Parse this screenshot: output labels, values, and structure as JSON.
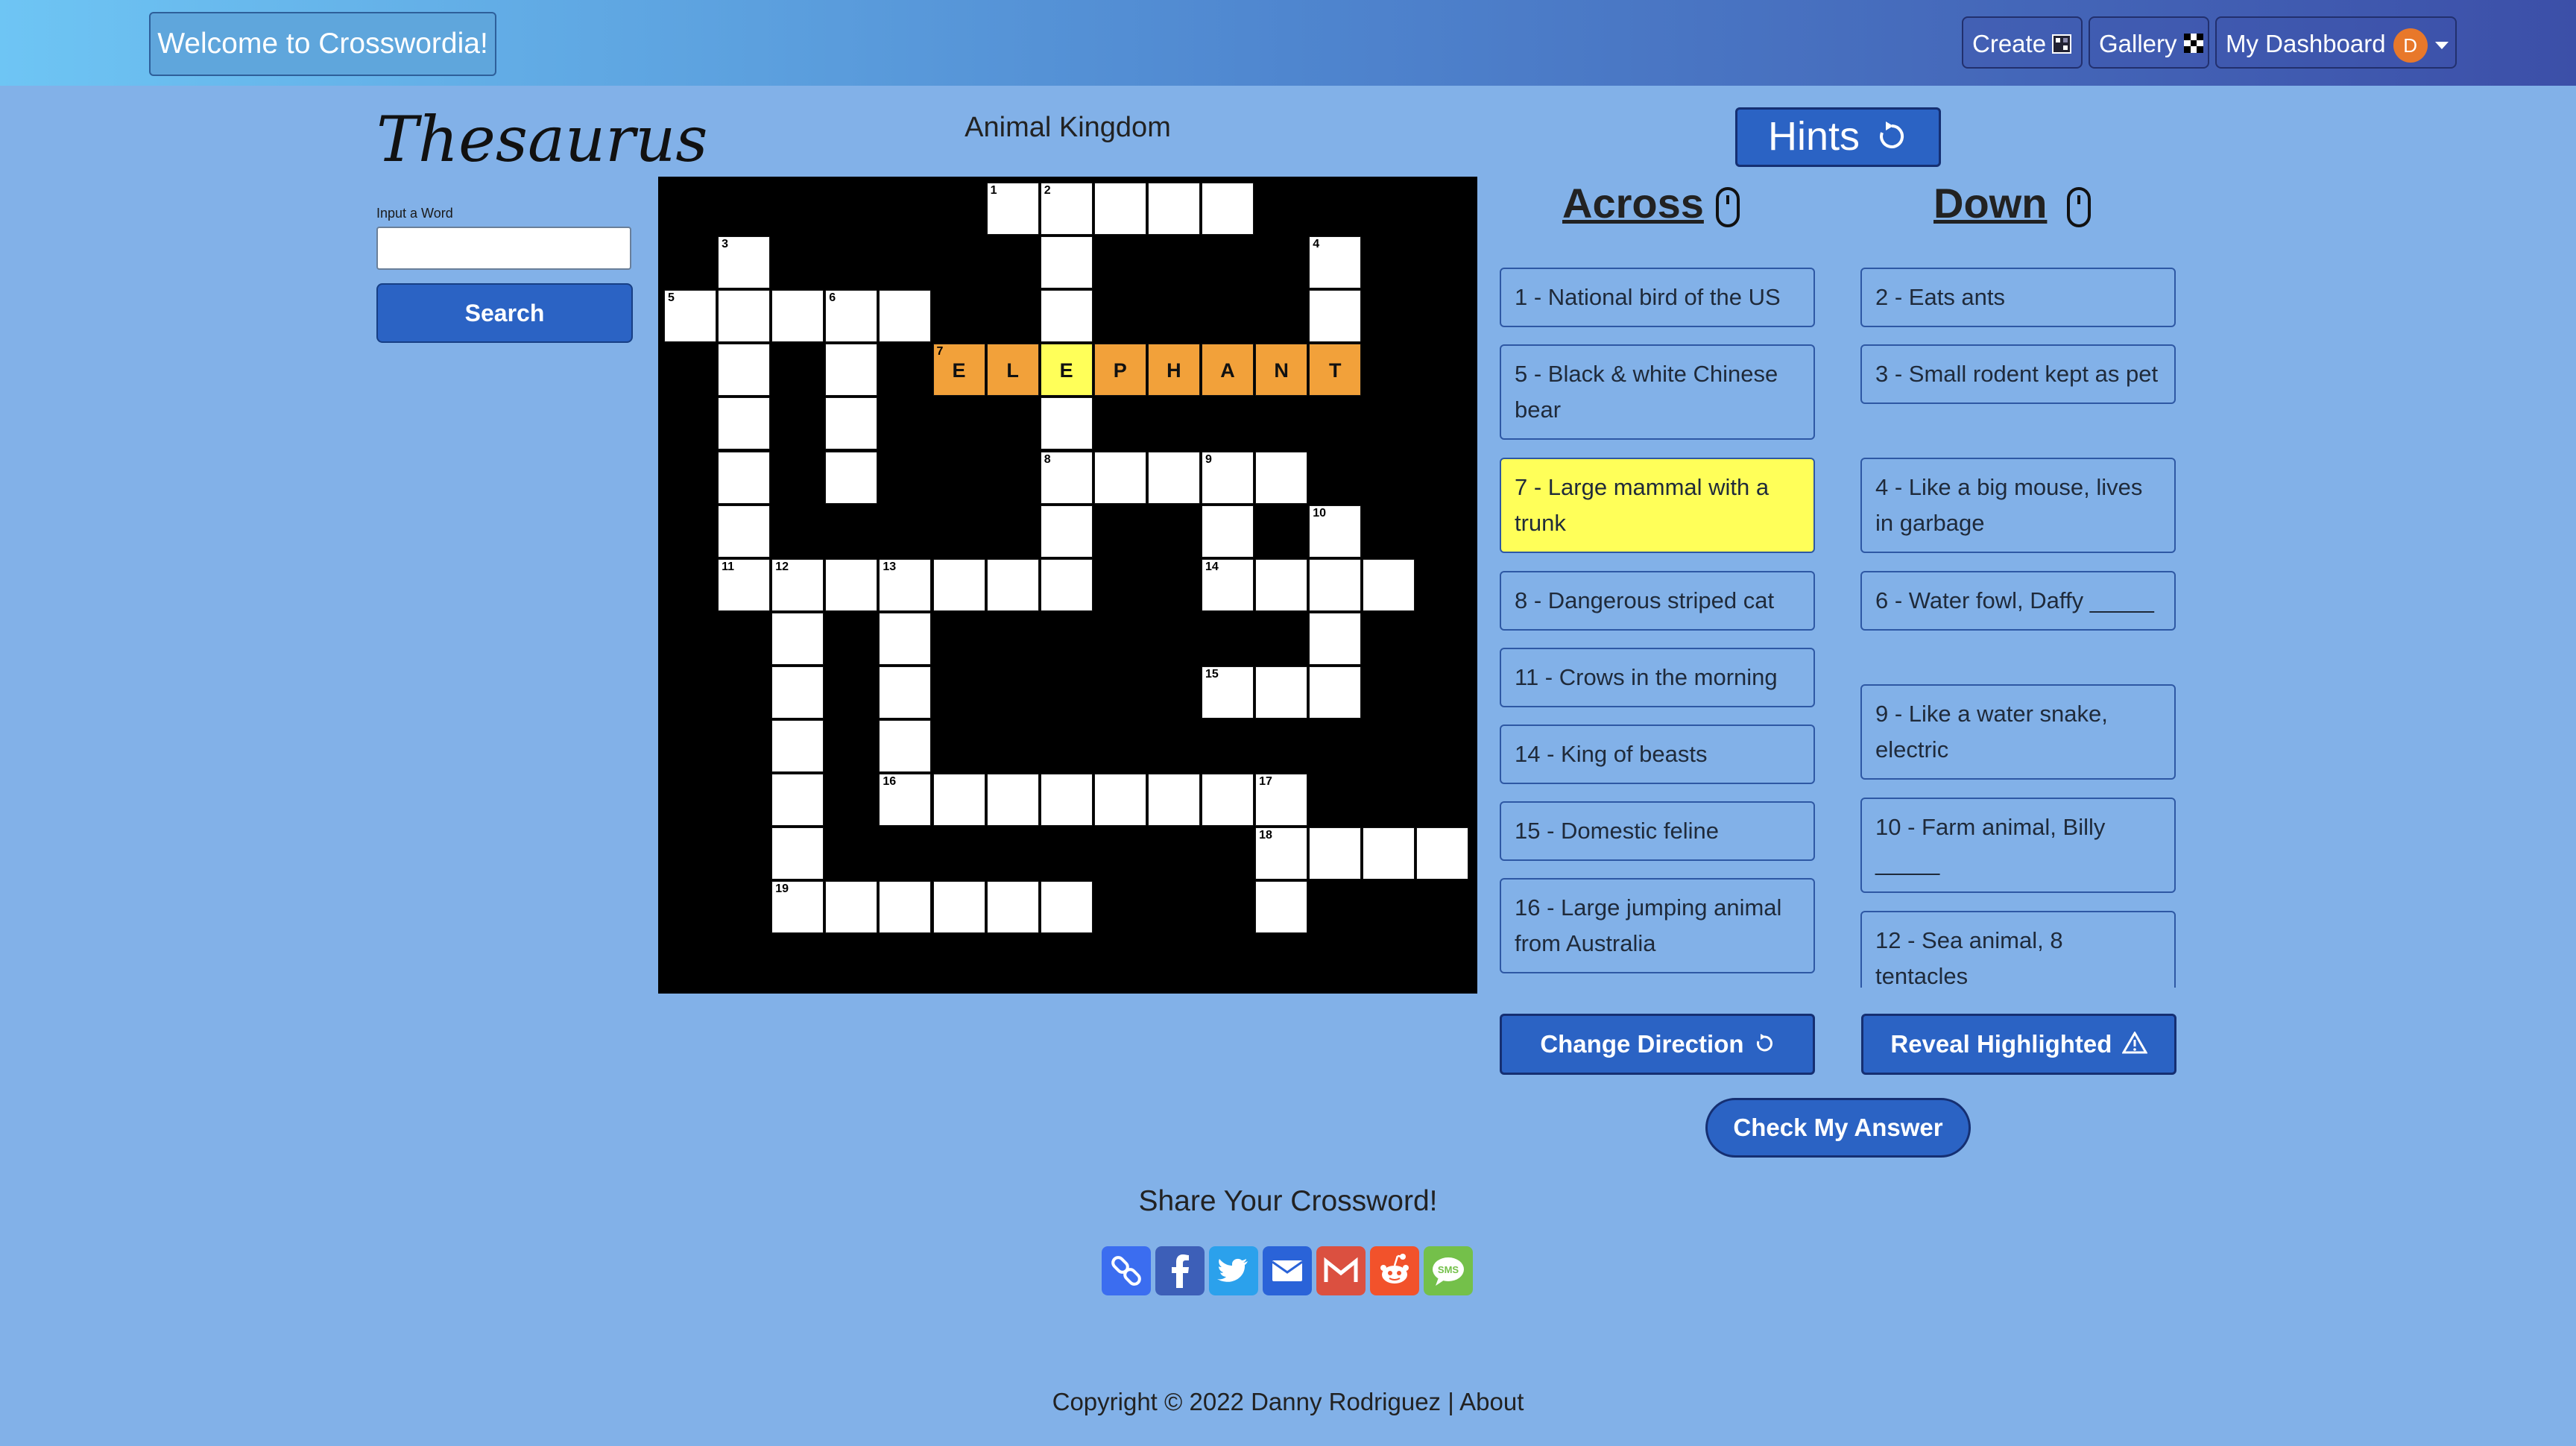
{
  "navbar": {
    "brand": "Welcome to Crosswordia!",
    "create": "Create",
    "gallery": "Gallery",
    "dashboard": "My Dashboard",
    "avatar_initial": "D"
  },
  "thesaurus": {
    "title": "Thesaurus",
    "input_label": "Input a Word",
    "input_value": "",
    "search_label": "Search"
  },
  "puzzle": {
    "title": "Animal Kingdom",
    "cells": [
      {
        "r": 0,
        "c": 6,
        "n": "1"
      },
      {
        "r": 0,
        "c": 7,
        "n": "2"
      },
      {
        "r": 0,
        "c": 8
      },
      {
        "r": 0,
        "c": 9
      },
      {
        "r": 0,
        "c": 10
      },
      {
        "r": 1,
        "c": 1,
        "n": "3"
      },
      {
        "r": 1,
        "c": 7
      },
      {
        "r": 1,
        "c": 12,
        "n": "4"
      },
      {
        "r": 2,
        "c": 0,
        "n": "5"
      },
      {
        "r": 2,
        "c": 1
      },
      {
        "r": 2,
        "c": 2
      },
      {
        "r": 2,
        "c": 3,
        "n": "6"
      },
      {
        "r": 2,
        "c": 4
      },
      {
        "r": 2,
        "c": 7
      },
      {
        "r": 2,
        "c": 12
      },
      {
        "r": 3,
        "c": 1
      },
      {
        "r": 3,
        "c": 3
      },
      {
        "r": 3,
        "c": 5,
        "n": "7",
        "l": "E",
        "hl": "o"
      },
      {
        "r": 3,
        "c": 6,
        "l": "L",
        "hl": "o"
      },
      {
        "r": 3,
        "c": 7,
        "l": "E",
        "hl": "y"
      },
      {
        "r": 3,
        "c": 8,
        "l": "P",
        "hl": "o"
      },
      {
        "r": 3,
        "c": 9,
        "l": "H",
        "hl": "o"
      },
      {
        "r": 3,
        "c": 10,
        "l": "A",
        "hl": "o"
      },
      {
        "r": 3,
        "c": 11,
        "l": "N",
        "hl": "o"
      },
      {
        "r": 3,
        "c": 12,
        "l": "T",
        "hl": "o"
      },
      {
        "r": 4,
        "c": 1
      },
      {
        "r": 4,
        "c": 3
      },
      {
        "r": 4,
        "c": 7
      },
      {
        "r": 5,
        "c": 1
      },
      {
        "r": 5,
        "c": 3
      },
      {
        "r": 5,
        "c": 7,
        "n": "8"
      },
      {
        "r": 5,
        "c": 8
      },
      {
        "r": 5,
        "c": 9
      },
      {
        "r": 5,
        "c": 10,
        "n": "9"
      },
      {
        "r": 5,
        "c": 11
      },
      {
        "r": 6,
        "c": 1
      },
      {
        "r": 6,
        "c": 7
      },
      {
        "r": 6,
        "c": 10
      },
      {
        "r": 6,
        "c": 12,
        "n": "10"
      },
      {
        "r": 7,
        "c": 1,
        "n": "11"
      },
      {
        "r": 7,
        "c": 2,
        "n": "12"
      },
      {
        "r": 7,
        "c": 3
      },
      {
        "r": 7,
        "c": 4,
        "n": "13"
      },
      {
        "r": 7,
        "c": 5
      },
      {
        "r": 7,
        "c": 6
      },
      {
        "r": 7,
        "c": 7
      },
      {
        "r": 7,
        "c": 10,
        "n": "14"
      },
      {
        "r": 7,
        "c": 11
      },
      {
        "r": 7,
        "c": 12
      },
      {
        "r": 7,
        "c": 13
      },
      {
        "r": 8,
        "c": 2
      },
      {
        "r": 8,
        "c": 4
      },
      {
        "r": 8,
        "c": 12
      },
      {
        "r": 9,
        "c": 2
      },
      {
        "r": 9,
        "c": 4
      },
      {
        "r": 9,
        "c": 10,
        "n": "15"
      },
      {
        "r": 9,
        "c": 11
      },
      {
        "r": 9,
        "c": 12
      },
      {
        "r": 10,
        "c": 2
      },
      {
        "r": 10,
        "c": 4
      },
      {
        "r": 11,
        "c": 2
      },
      {
        "r": 11,
        "c": 4,
        "n": "16"
      },
      {
        "r": 11,
        "c": 5
      },
      {
        "r": 11,
        "c": 6
      },
      {
        "r": 11,
        "c": 7
      },
      {
        "r": 11,
        "c": 8
      },
      {
        "r": 11,
        "c": 9
      },
      {
        "r": 11,
        "c": 10
      },
      {
        "r": 11,
        "c": 11,
        "n": "17"
      },
      {
        "r": 12,
        "c": 2
      },
      {
        "r": 12,
        "c": 11,
        "n": "18"
      },
      {
        "r": 12,
        "c": 12
      },
      {
        "r": 12,
        "c": 13
      },
      {
        "r": 12,
        "c": 14
      },
      {
        "r": 13,
        "c": 2,
        "n": "19"
      },
      {
        "r": 13,
        "c": 3
      },
      {
        "r": 13,
        "c": 4
      },
      {
        "r": 13,
        "c": 5
      },
      {
        "r": 13,
        "c": 6
      },
      {
        "r": 13,
        "c": 7
      },
      {
        "r": 13,
        "c": 11
      }
    ]
  },
  "hints_label": "Hints",
  "across": {
    "title": "Across",
    "clues": [
      {
        "text": "1 - National bird of the US"
      },
      {
        "text": "5 - Black & white Chinese bear"
      },
      {
        "text": "7 - Large mammal with a trunk",
        "active": true
      },
      {
        "text": "8 - Dangerous striped cat"
      },
      {
        "text": "11 - Crows in the morning"
      },
      {
        "text": "14 - King of beasts"
      },
      {
        "text": "15 - Domestic feline"
      },
      {
        "text": "16 - Large jumping animal from Australia"
      }
    ]
  },
  "down": {
    "title": "Down",
    "clues": [
      {
        "text": "2 - Eats ants"
      },
      {
        "text": "3 - Small rodent kept as pet"
      },
      {
        "text": "4 - Like a big mouse, lives in garbage"
      },
      {
        "text": "6 - Water fowl, Daffy _____"
      },
      {
        "text": "9 - Like a water snake, electric"
      },
      {
        "text": "10 - Farm animal, Billy _____"
      },
      {
        "text": "12 - Sea animal, 8 tentacles"
      }
    ]
  },
  "buttons": {
    "change_direction": "Change Direction",
    "reveal_highlighted": "Reveal Highlighted",
    "check_answer": "Check My Answer"
  },
  "share": {
    "title": "Share Your Crossword!",
    "icons": [
      "link-icon",
      "facebook-icon",
      "twitter-icon",
      "email-icon",
      "gmail-icon",
      "reddit-icon",
      "sms-icon"
    ]
  },
  "footer": {
    "copyright": "Copyright © 2022 Danny Rodriguez | ",
    "about": "About"
  },
  "colors": {
    "background": "#82b1e8",
    "primary_button": "#2b63c4",
    "highlight_word": "#f2a13a",
    "highlight_cell": "#ffff59",
    "active_clue": "#ffff59"
  }
}
